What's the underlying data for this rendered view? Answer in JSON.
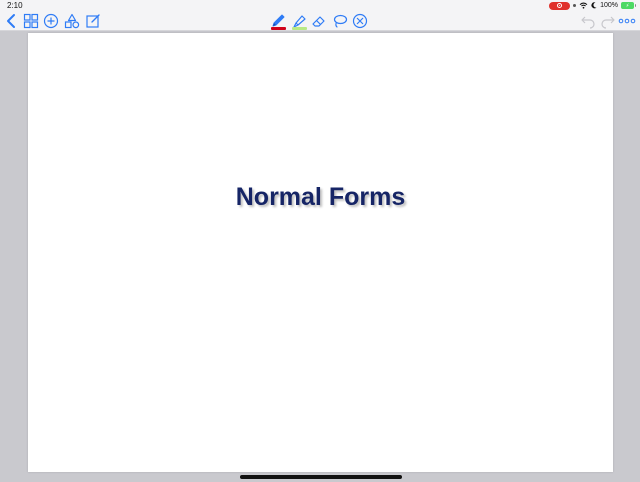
{
  "status_bar": {
    "time": "2:10",
    "battery_label": "100%"
  },
  "toolbar": {
    "left_icons": [
      "chevron-left-icon",
      "grid-icon",
      "plus-circle-icon",
      "shapes-icon",
      "edit-icon"
    ],
    "tools": [
      "pen-icon",
      "highlighter-icon",
      "eraser-icon",
      "lasso-icon",
      "close-circle-icon"
    ],
    "right_icons": [
      "undo-icon",
      "redo-icon",
      "more-icon"
    ],
    "pen_color": "#d0021b",
    "highlighter_color": "#b8e986",
    "accent": "#2f7cf6"
  },
  "page": {
    "title": "Normal Forms"
  }
}
